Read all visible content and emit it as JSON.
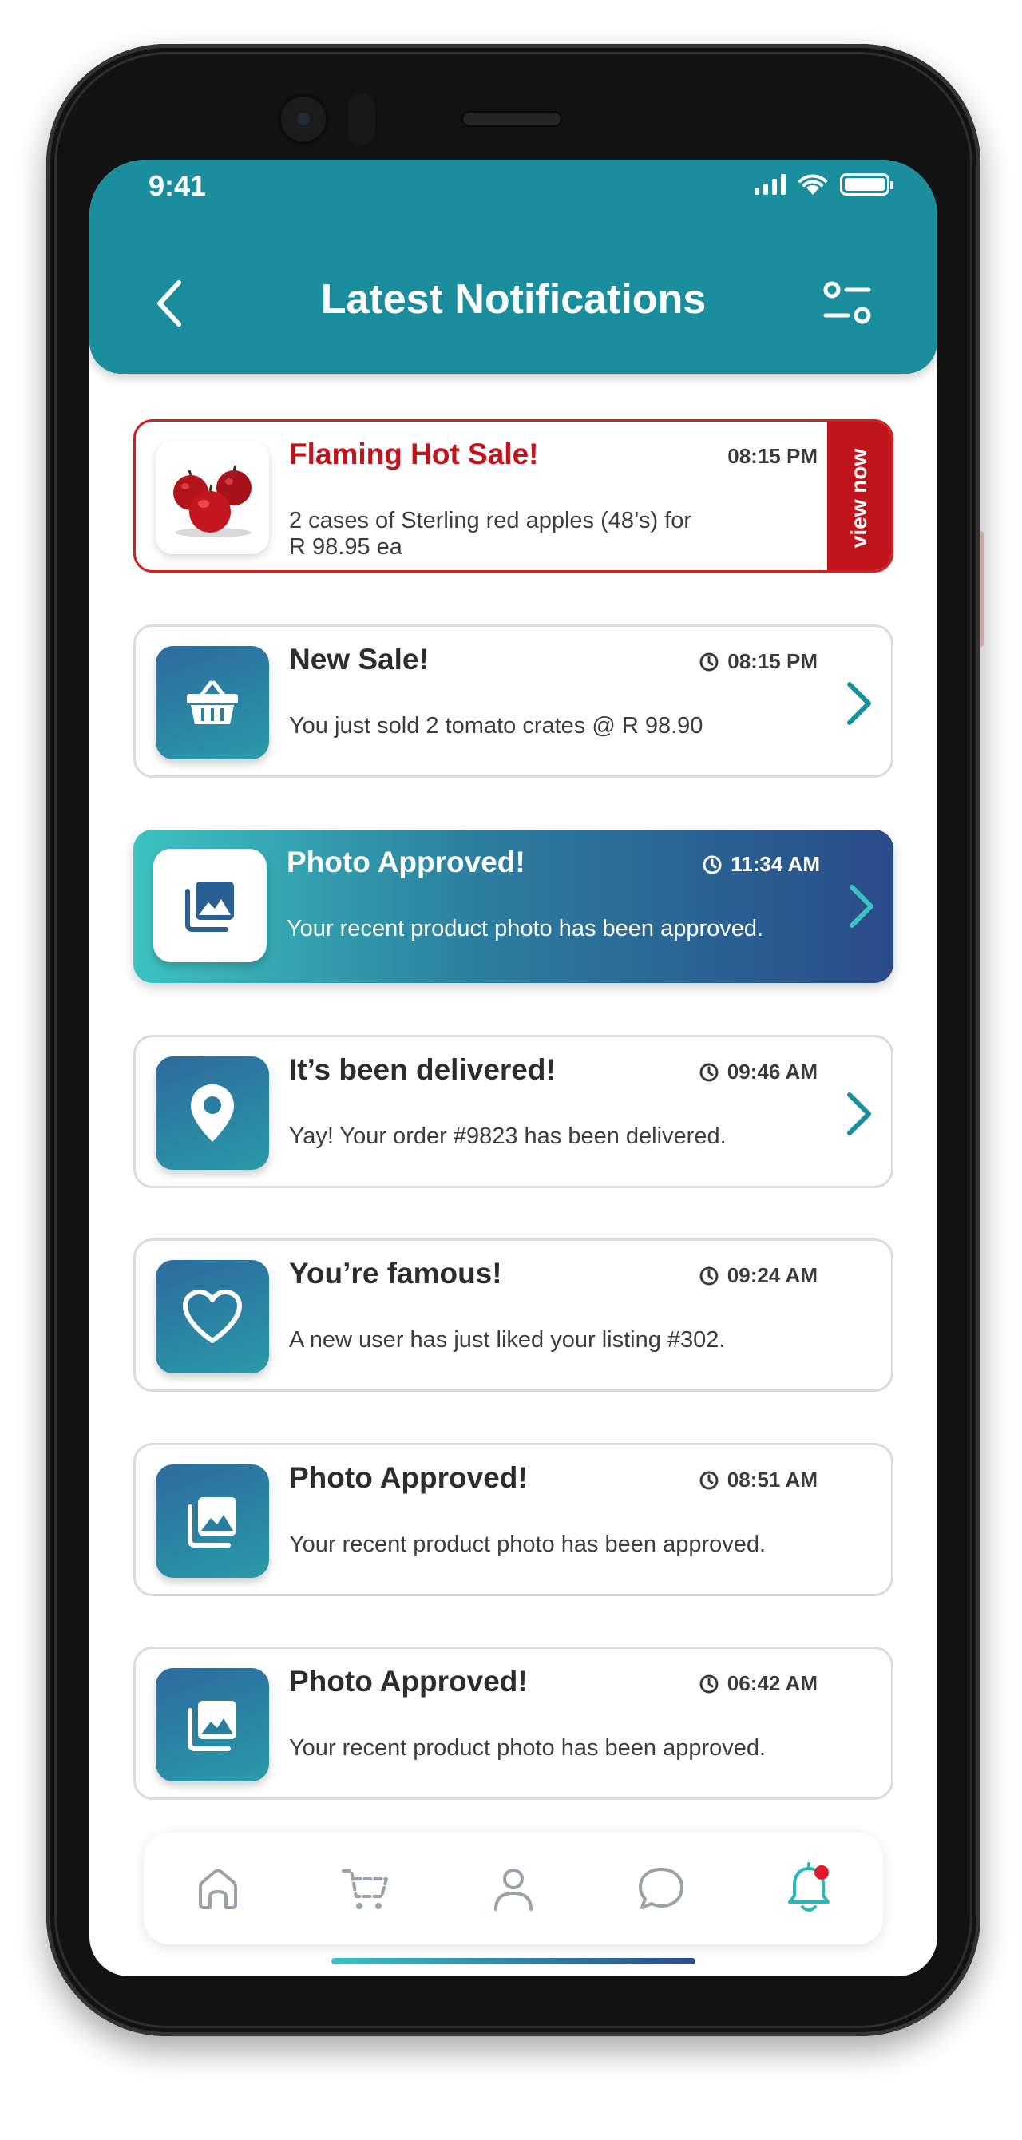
{
  "status_bar": {
    "time": "9:41"
  },
  "header": {
    "title": "Latest Notifications"
  },
  "colors": {
    "primary": "#1b8e9e",
    "sale_red": "#c0141c",
    "gradient_start": "#3cc2c0",
    "gradient_end": "#2a4b8a",
    "badge": "#e01a2b"
  },
  "notifications": [
    {
      "title": "Flaming Hot Sale!",
      "time": "08:15 PM",
      "body": "2 cases of Sterling red apples (48’s) for R 98.95 ea",
      "action": "view now",
      "icon": "apples-image"
    },
    {
      "title": "New Sale!",
      "time": "08:15 PM",
      "body": "You just sold 2 tomato crates @ R 98.90",
      "icon": "basket-icon"
    },
    {
      "title": "Photo Approved!",
      "time": "11:34 AM",
      "body": "Your recent product photo has been approved.",
      "icon": "photo-icon"
    },
    {
      "title": "It’s been delivered!",
      "time": "09:46 AM",
      "body": "Yay! Your order #9823 has been delivered.",
      "icon": "location-pin-icon"
    },
    {
      "title": "You’re famous!",
      "time": "09:24 AM",
      "body": "A new user has just liked your listing #302.",
      "icon": "heart-icon"
    },
    {
      "title": "Photo Approved!",
      "time": "08:51 AM",
      "body": "Your recent product photo has been approved.",
      "icon": "photo-icon"
    },
    {
      "title": "Photo Approved!",
      "time": "06:42 AM",
      "body": "Your recent product photo has been approved.",
      "icon": "photo-icon"
    }
  ],
  "bottom_nav": [
    {
      "icon": "home-icon",
      "active": false
    },
    {
      "icon": "cart-icon",
      "active": false
    },
    {
      "icon": "profile-icon",
      "active": false
    },
    {
      "icon": "chat-icon",
      "active": false
    },
    {
      "icon": "bell-icon",
      "active": true
    }
  ]
}
